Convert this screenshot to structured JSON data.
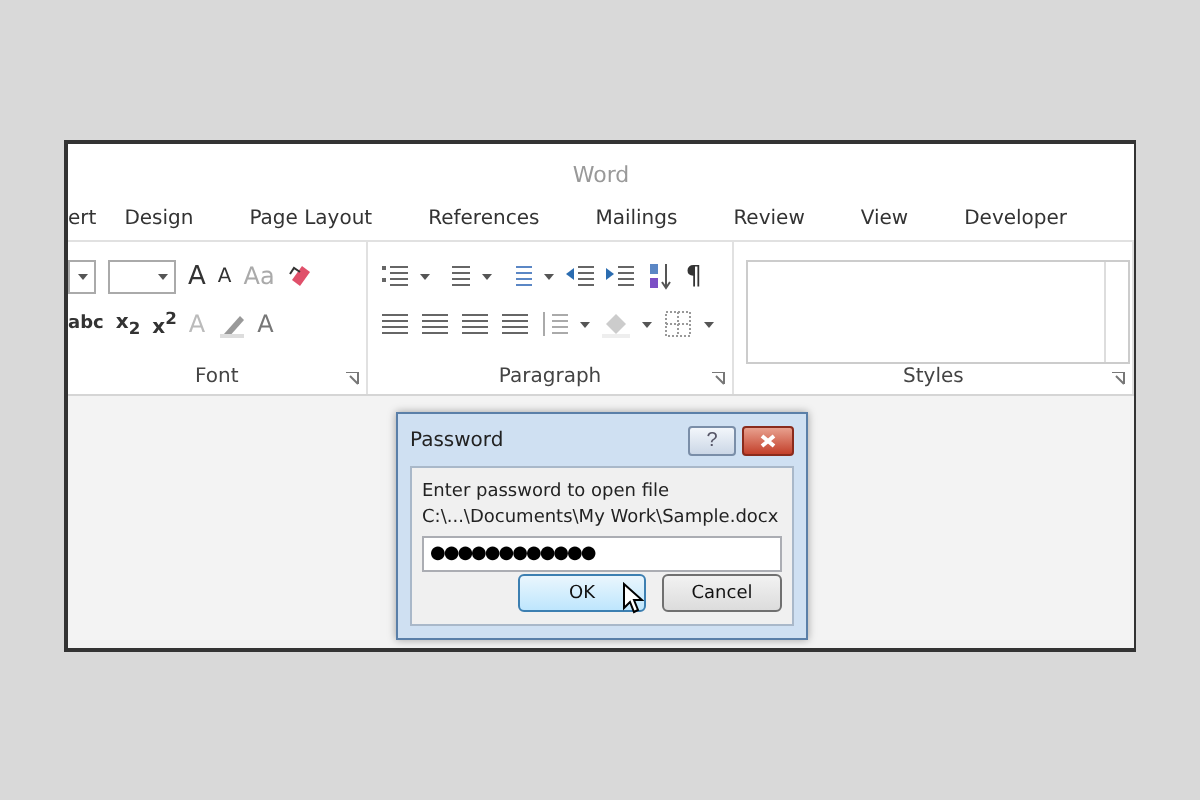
{
  "window": {
    "title": "Word"
  },
  "tabs": [
    {
      "label": "ert",
      "selected": false
    },
    {
      "label": "Design",
      "selected": false
    },
    {
      "label": "Page Layout",
      "selected": false
    },
    {
      "label": "References",
      "selected": false
    },
    {
      "label": "Mailings",
      "selected": false
    },
    {
      "label": "Review",
      "selected": false
    },
    {
      "label": "View",
      "selected": false
    },
    {
      "label": "Developer",
      "selected": false
    }
  ],
  "ribbon": {
    "font": {
      "label": "Font",
      "row1": [
        "A",
        "A",
        "Aa"
      ],
      "row2": [
        "abc",
        "x$_{2}$",
        "x$^{2}$",
        "A",
        "A"
      ]
    },
    "paragraph": {
      "label": "Paragraph",
      "row1_mark": "¶"
    },
    "styles": {
      "label": "Styles"
    }
  },
  "dialog": {
    "title": "Password",
    "help": "?",
    "prompt": "Enter password to open file",
    "path": "C:\\...\\Documents\\My Work\\Sample.docx",
    "password": "●●●●●●●●●●●●",
    "buttons": [
      {
        "label": "OK",
        "selected": true
      },
      {
        "label": "Cancel",
        "selected": false
      }
    ]
  }
}
